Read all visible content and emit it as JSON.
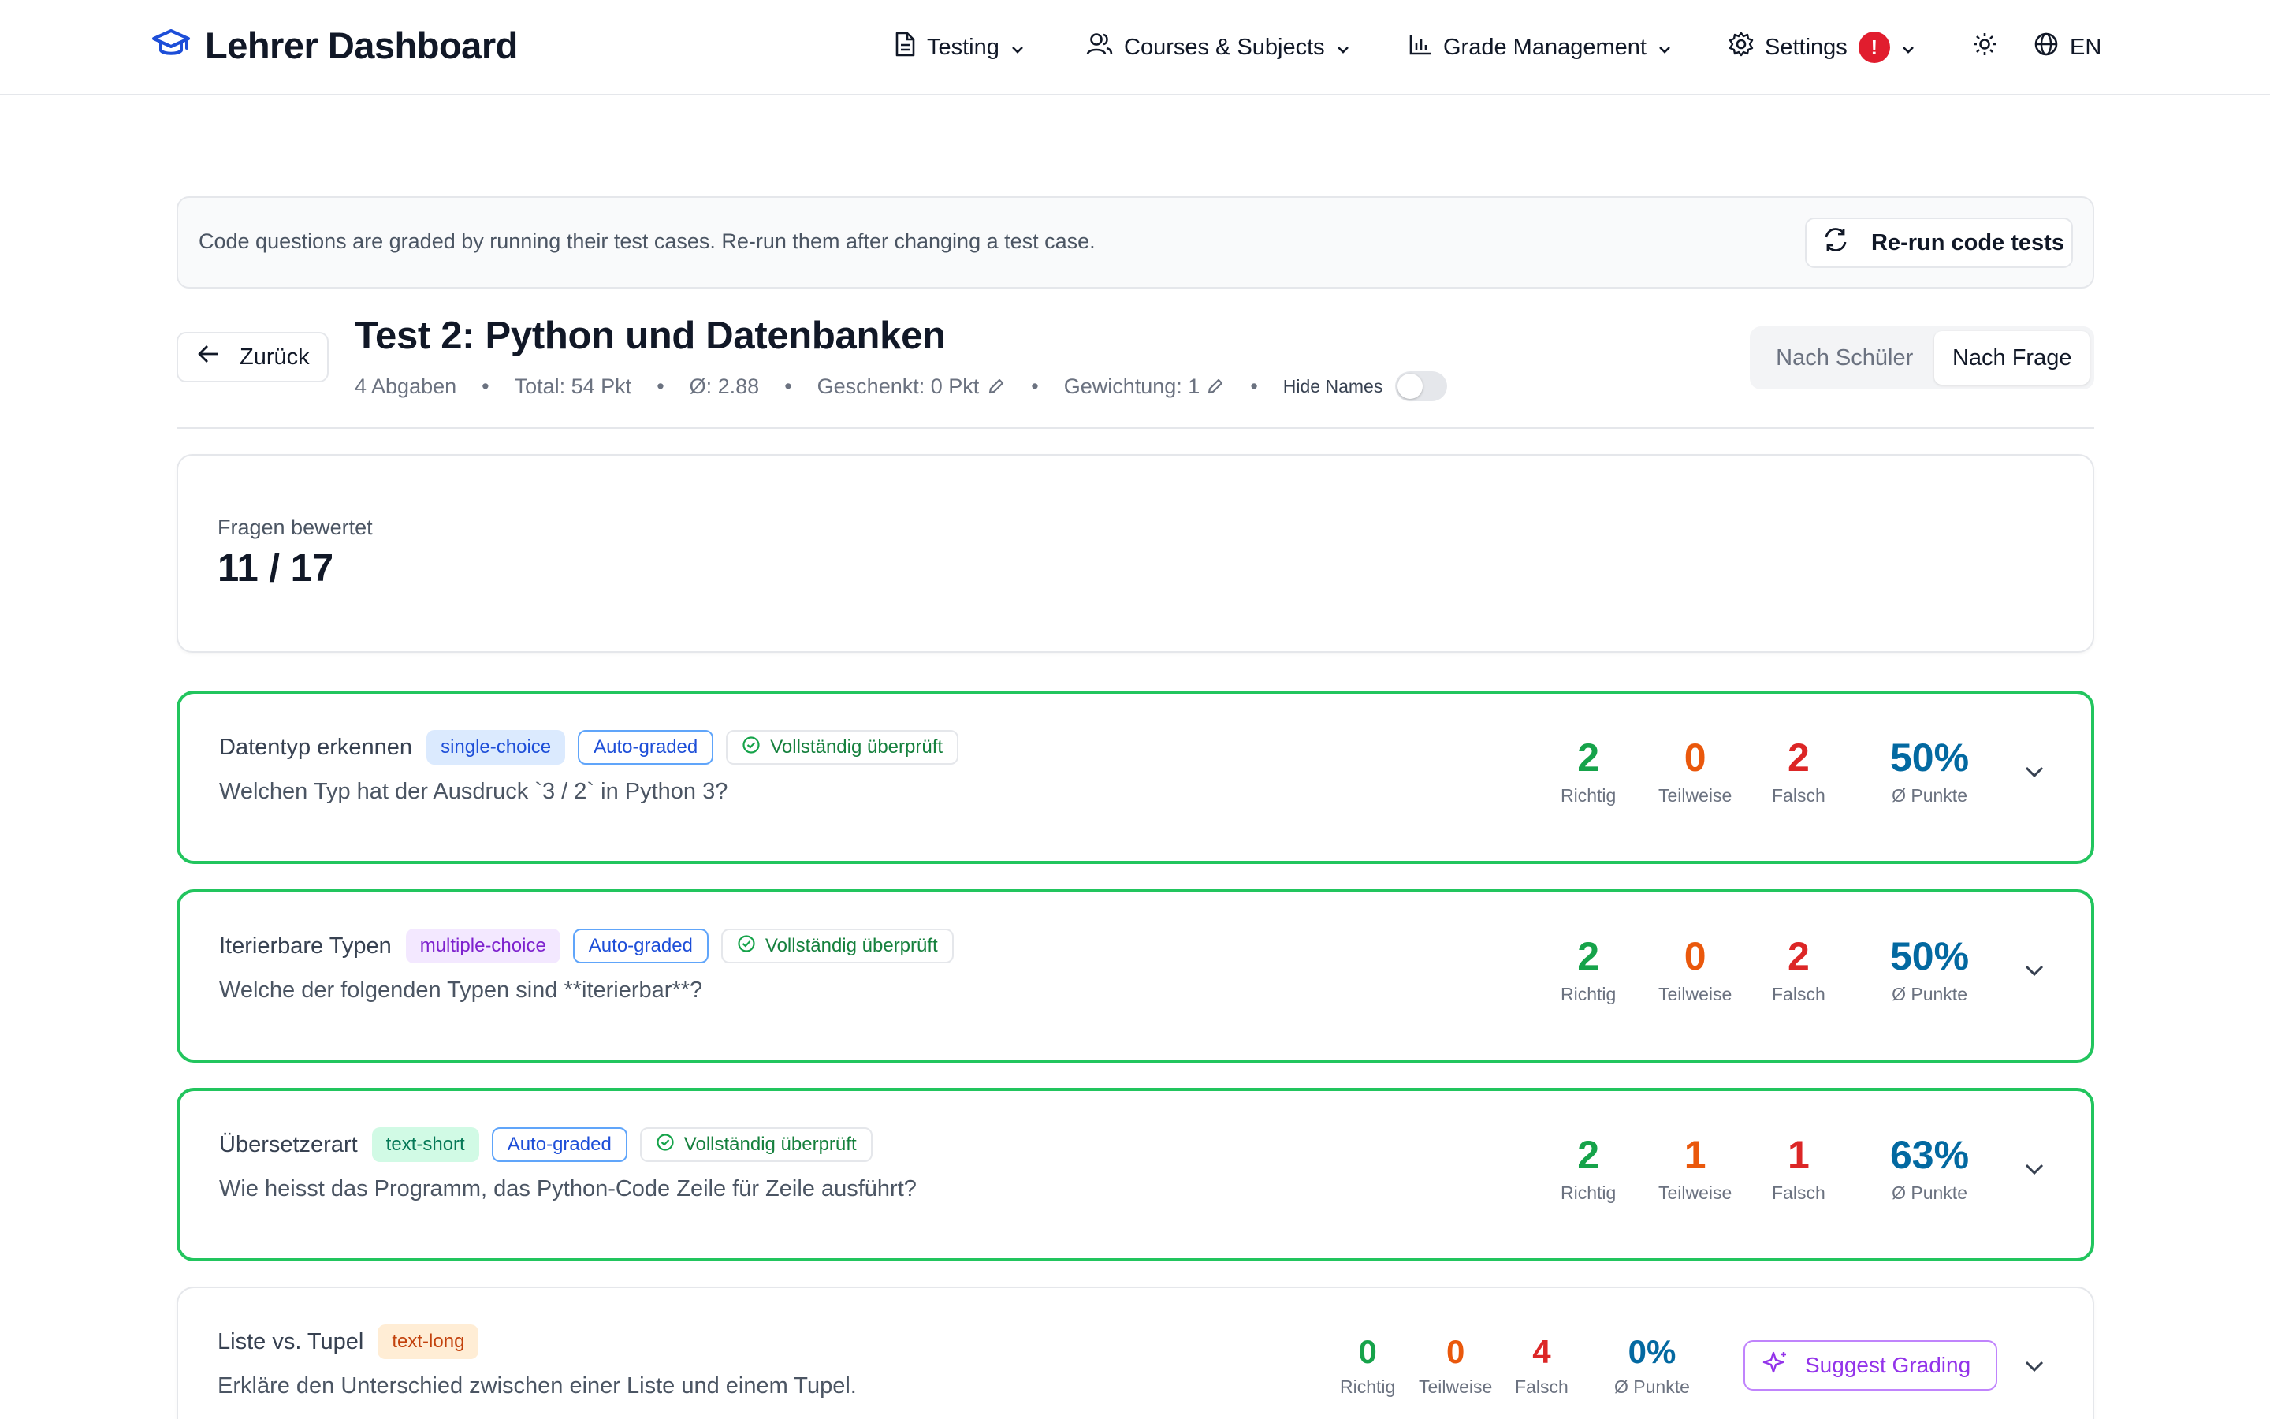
{
  "app": {
    "title": "Lehrer Dashboard"
  },
  "nav": {
    "items": [
      {
        "label": "Testing",
        "icon": "document-icon"
      },
      {
        "label": "Courses & Subjects",
        "icon": "users-icon"
      },
      {
        "label": "Grade Management",
        "icon": "bar-chart-icon"
      },
      {
        "label": "Settings",
        "icon": "gear-icon",
        "badge": "!"
      }
    ],
    "theme_icon": "sun-icon",
    "language": "EN"
  },
  "banner": {
    "text": "Code questions are graded by running their test cases. Re-run them after changing a test case.",
    "button_label": "Re-run code tests"
  },
  "header": {
    "back_label": "Zurück",
    "title": "Test 2: Python und Datenbanken",
    "meta": {
      "submissions": "4 Abgaben",
      "total": "Total: 54 Pkt",
      "average": "Ø: 2.88",
      "gifted": "Geschenkt: 0 Pkt",
      "weight": "Gewichtung: 1",
      "hide_names_label": "Hide Names",
      "hide_names_on": false
    },
    "view_toggle": {
      "by_student": "Nach Schüler",
      "by_question": "Nach Frage",
      "active": "by_question"
    }
  },
  "summary": {
    "label": "Fragen bewertet",
    "value": "11 / 17"
  },
  "questions": [
    {
      "title": "Datentyp erkennen",
      "type": "single-choice",
      "auto": "Auto-graded",
      "status": "Vollständig überprüft",
      "text": "Welchen Typ hat der Ausdruck `3 / 2` in Python 3?",
      "correct": "2",
      "partial": "0",
      "wrong": "2",
      "avg": "50%",
      "labels": {
        "correct": "Richtig",
        "partial": "Teilweise",
        "wrong": "Falsch",
        "avg": "Ø Punkte"
      }
    },
    {
      "title": "Iterierbare Typen",
      "type": "multiple-choice",
      "auto": "Auto-graded",
      "status": "Vollständig überprüft",
      "text": "Welche der folgenden Typen sind **iterierbar**?",
      "correct": "2",
      "partial": "0",
      "wrong": "2",
      "avg": "50%",
      "labels": {
        "correct": "Richtig",
        "partial": "Teilweise",
        "wrong": "Falsch",
        "avg": "Ø Punkte"
      }
    },
    {
      "title": "Übersetzerart",
      "type": "text-short",
      "auto": "Auto-graded",
      "status": "Vollständig überprüft",
      "text": "Wie heisst das Programm, das Python-Code Zeile für Zeile ausführt?",
      "correct": "2",
      "partial": "1",
      "wrong": "1",
      "avg": "63%",
      "labels": {
        "correct": "Richtig",
        "partial": "Teilweise",
        "wrong": "Falsch",
        "avg": "Ø Punkte"
      }
    },
    {
      "title": "Liste vs. Tupel",
      "type": "text-long",
      "text": "Erkläre den Unterschied zwischen einer Liste und einem Tupel.",
      "correct": "0",
      "partial": "0",
      "wrong": "4",
      "avg": "0%",
      "labels": {
        "correct": "Richtig",
        "partial": "Teilweise",
        "wrong": "Falsch",
        "avg": "Ø Punkte"
      },
      "action_label": "Suggest Grading"
    }
  ],
  "colors": {
    "brand": "#1d4ed8",
    "success_border": "#22c55e",
    "correct": "#16a34a",
    "partial": "#ea580c",
    "wrong": "#dc2626",
    "avg": "#0369a1",
    "ai_action": "#9333ea"
  }
}
